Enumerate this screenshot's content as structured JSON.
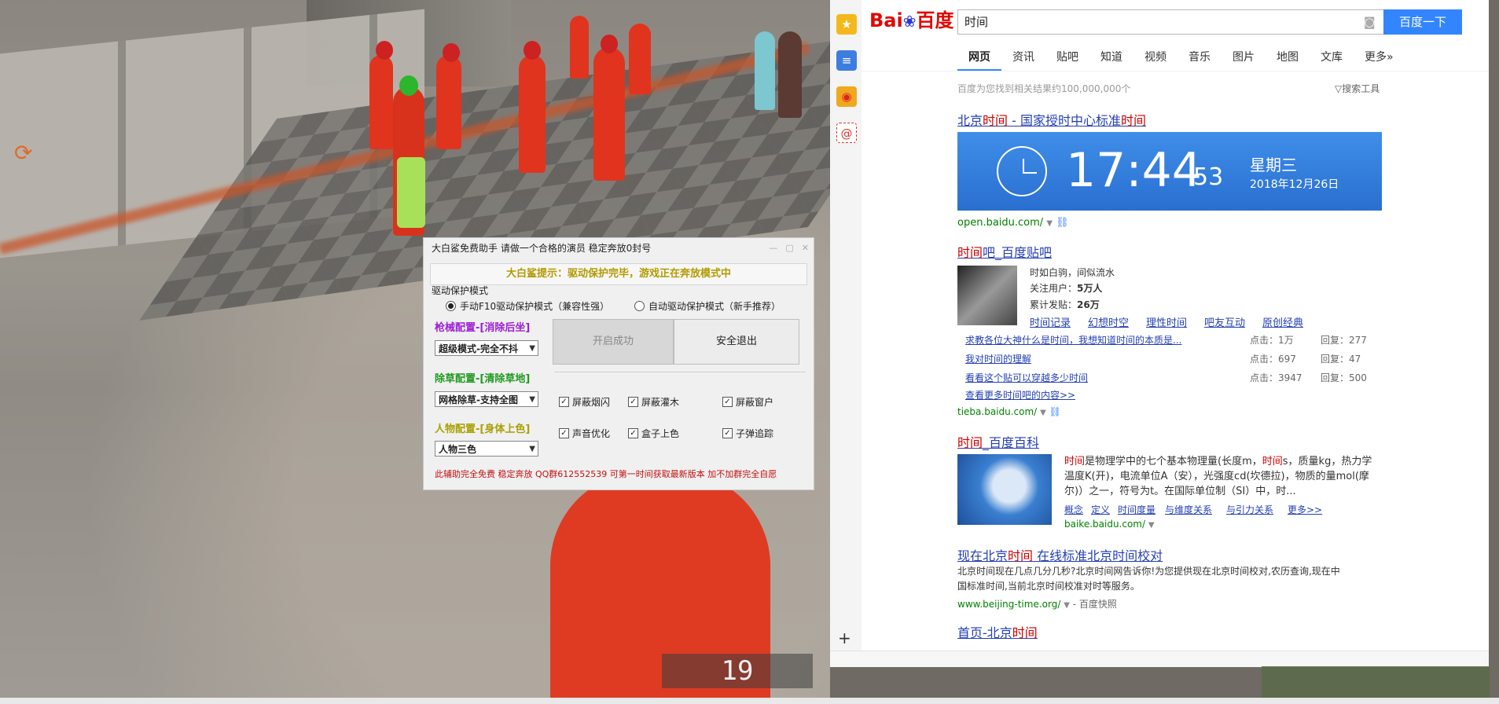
{
  "game": {
    "ammo_count": "19"
  },
  "cheat_window": {
    "title": "大白鲨免费助手 请做一个合格的演员 稳定奔放0封号",
    "notice": "大白鲨提示：驱动保护完毕，游戏正在奔放模式中",
    "driver_group_label": "驱动保护模式",
    "radio_manual": "手动F10驱动保护模式（兼容性强）",
    "radio_auto": "自动驱动保护模式（新手推荐）",
    "gun_config_label": "枪械配置-[消除后坐]",
    "gun_select": "超级模式-完全不抖",
    "grass_config_label": "除草配置-[清除草地]",
    "grass_select": "网格除草-支持全图",
    "char_config_label": "人物配置-[身体上色]",
    "char_select": "人物三色",
    "start_button": "开启成功",
    "exit_button": "安全退出",
    "checkboxes": [
      "屏蔽烟闪",
      "屏蔽灌木",
      "屏蔽窗户",
      "声音优化",
      "盒子上色",
      "子弹追踪"
    ],
    "footer": "此辅助完全免费 稳定奔放 QQ群612552539 可第一时间获取最新版本 加不加群完全自愿",
    "colors": {
      "notice": "#b39a00",
      "gun": "#9b1fd6",
      "grass": "#1e9a1e",
      "char": "#a8a000",
      "footer": "#c01010"
    }
  },
  "sidebar": {
    "icons": [
      "star-icon",
      "note-icon",
      "weibo-icon",
      "mail-icon"
    ],
    "plus": "+"
  },
  "baidu": {
    "logo_bai": "Bai",
    "logo_du": "百度",
    "query": "时间",
    "search_button": "百度一下",
    "tabs": [
      "网页",
      "资讯",
      "贴吧",
      "知道",
      "视频",
      "音乐",
      "图片",
      "地图",
      "文库",
      "更多»"
    ],
    "result_count": "百度为您找到相关结果约100,000,000个",
    "search_tools": "搜索工具",
    "r1": {
      "title_a": "北京",
      "title_hl1": "时间",
      "title_b": " - 国家授时中心标准",
      "title_hl2": "时间",
      "time": "17:44",
      "seconds": "53",
      "weekday": "星期三",
      "date": "2018年12月26日",
      "url": "open.baidu.com/"
    },
    "r2": {
      "title_hl": "时间",
      "title_b": "吧_百度贴吧",
      "desc": "时如白驹，间似流水",
      "followers_label": "关注用户：",
      "followers": "5万人",
      "posts_label": "累计发贴：",
      "posts": "26万",
      "tags": [
        "时间记录",
        "幻想时空",
        "理性时间",
        "吧友互动",
        "原创经典"
      ],
      "threads": [
        {
          "title": "求教各位大神什么是时间，我想知道时间的本质是...",
          "clicks": "点击：1万",
          "replies": "回复：277"
        },
        {
          "title": "我对时间的理解",
          "clicks": "点击：697",
          "replies": "回复：47"
        },
        {
          "title": "看看这个贴可以穿越多少时间",
          "clicks": "点击：3947",
          "replies": "回复：500"
        }
      ],
      "more": "查看更多时间吧的内容>>",
      "url": "tieba.baidu.com/"
    },
    "r3": {
      "title_hl": "时间",
      "title_b": "_百度百科",
      "abstract_l1": "是物理学中的七个基本物理量(长度m，",
      "abstract_hl1": "时间",
      "abstract_hl2": "时间",
      "abstract_l1b": "s，质量kg，热力学",
      "abstract_l2": "温度K(开)，电流单位A（安），光强度cd(坎德拉)，物质的量mol(摩",
      "abstract_l3": "尔)）之一，符号为t。在国际单位制（SI）中，时...",
      "links": [
        "概念",
        "定义",
        "时间度量",
        "与维度关系",
        "与引力关系",
        "更多>>"
      ],
      "url": "baike.baidu.com/"
    },
    "r4": {
      "title_a": "现在北京",
      "title_hl": "时间",
      "title_b": " 在线标准北京时间校对",
      "line1": "北京时间现在几点几分几秒?北京时间网告诉你!为您提供现在北京时间校对,农历查询,现在中",
      "line2": "国标准时间,当前北京时间校准对时等服务。",
      "url": "www.beijing-time.org/",
      "cache": "- 百度快照"
    },
    "r5": {
      "title_a": "首页-北京",
      "title_hl": "时间"
    }
  }
}
